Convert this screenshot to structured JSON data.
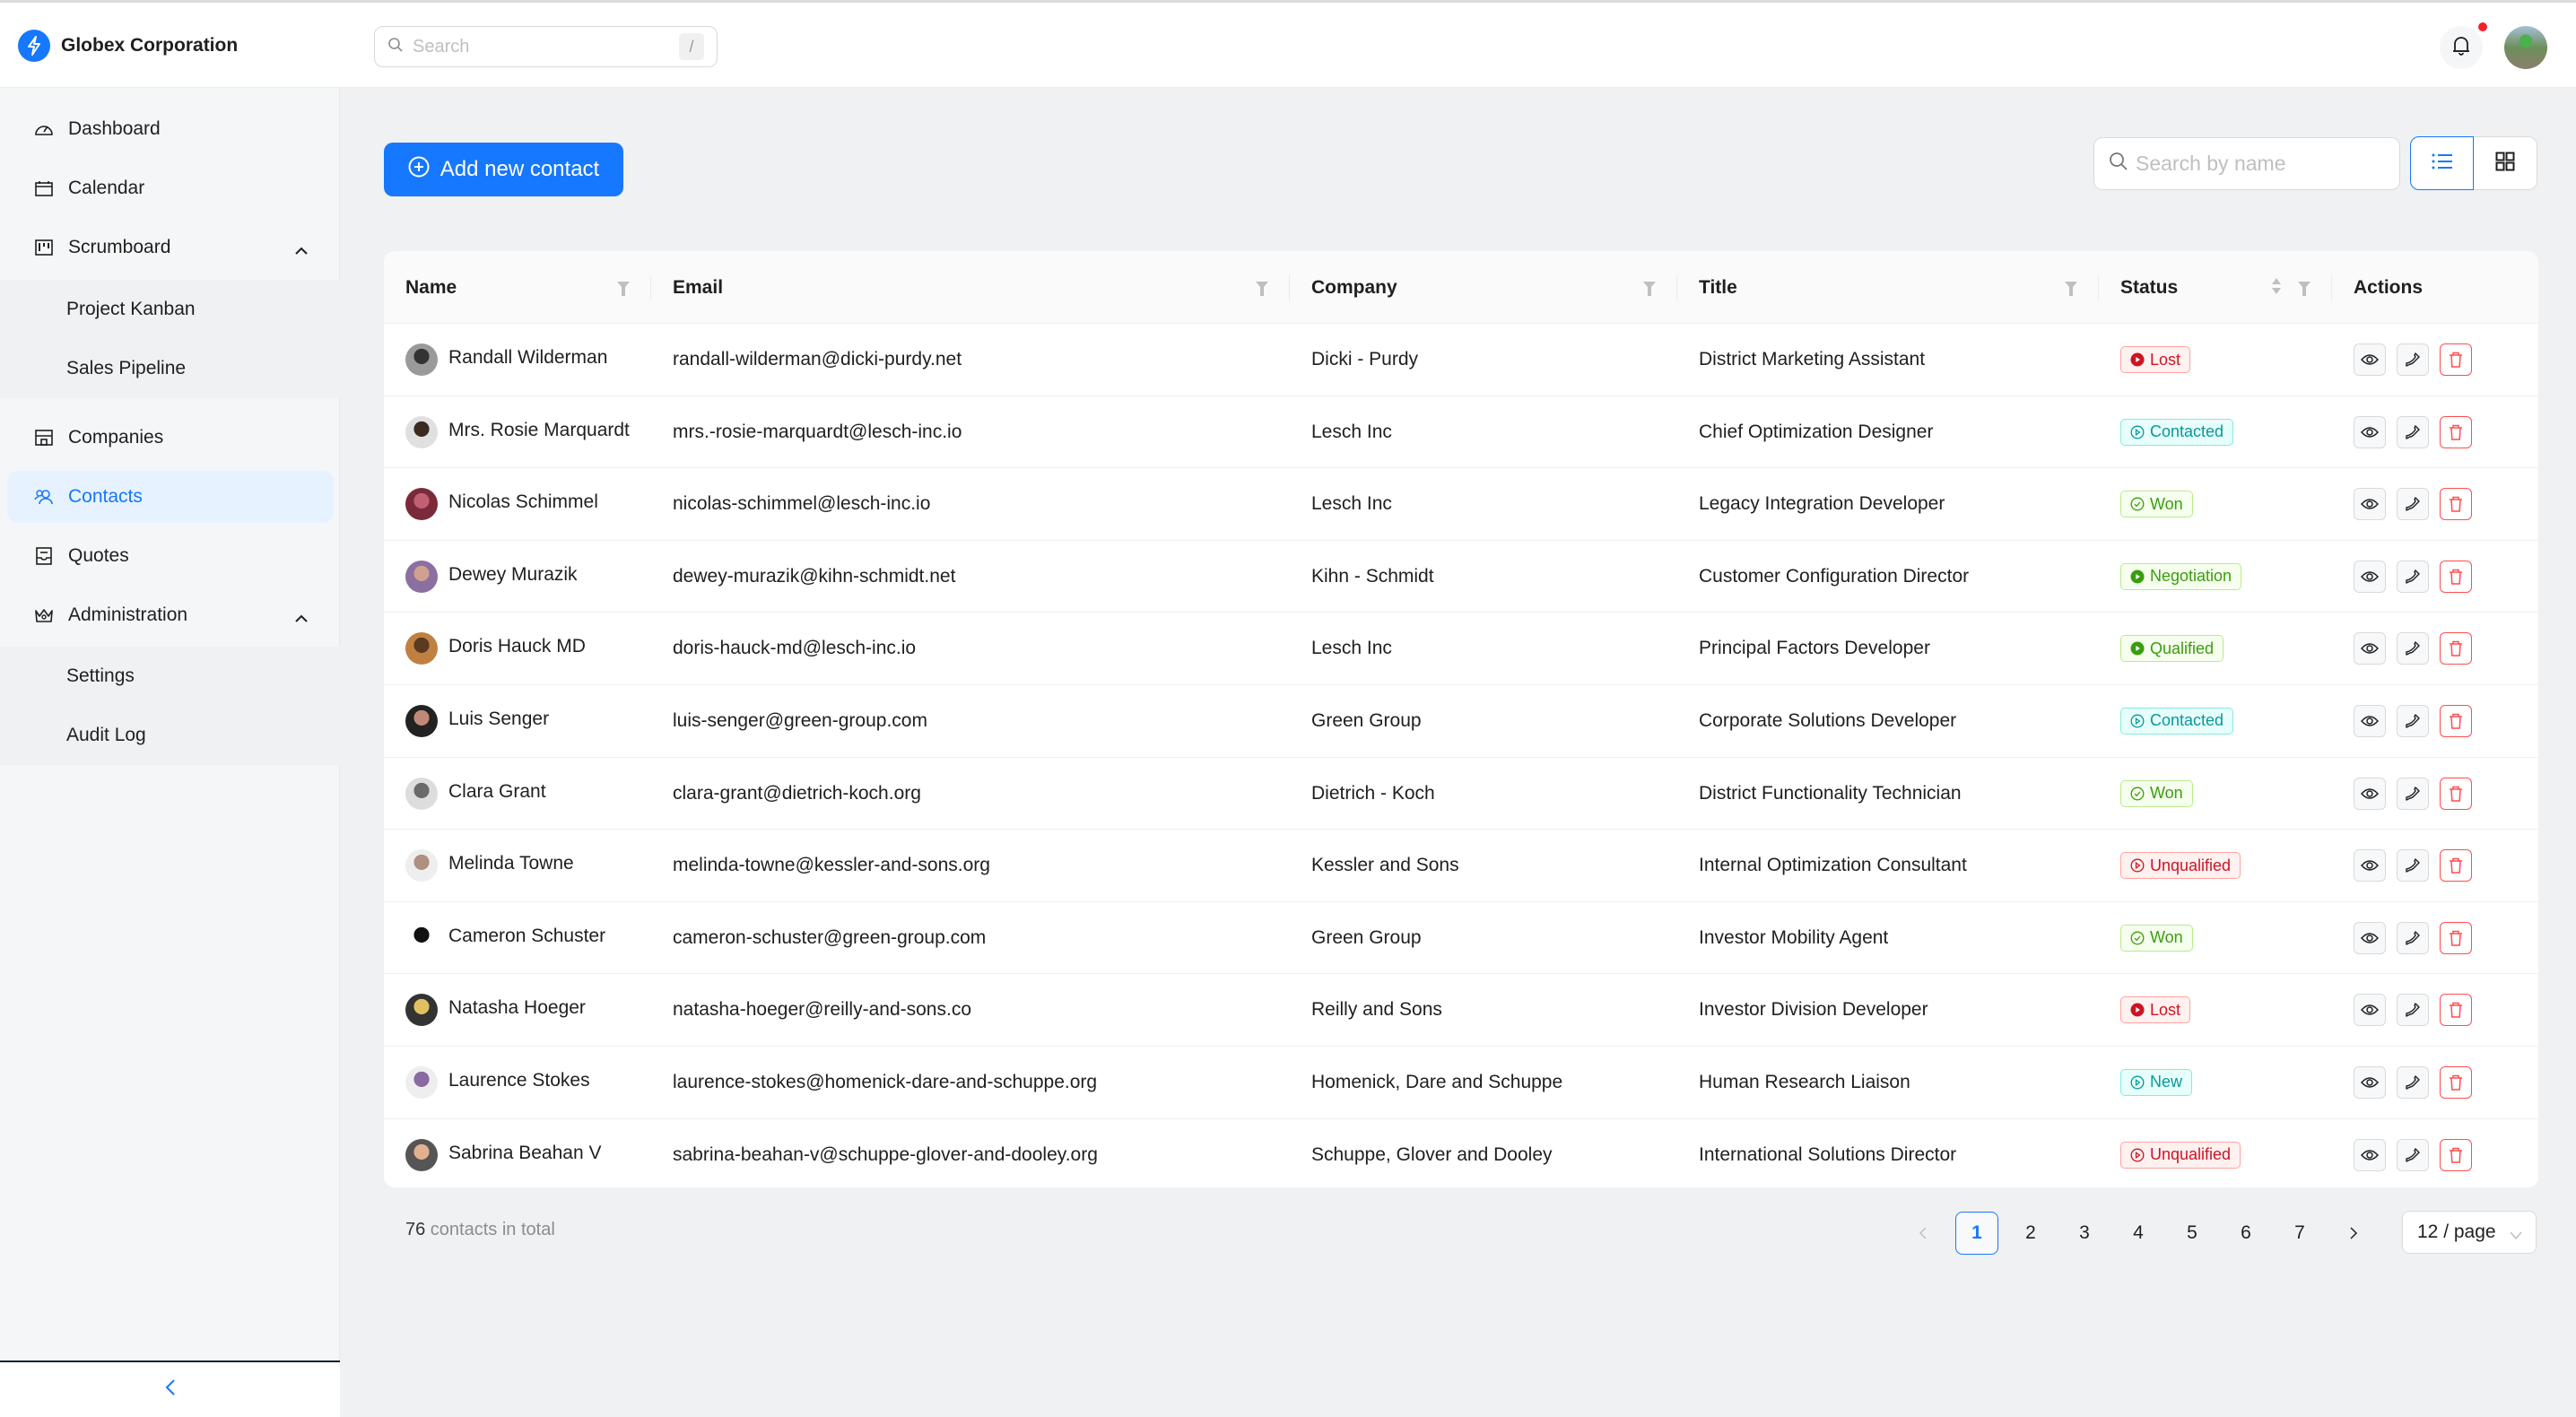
{
  "app": {
    "brand_name": "Globex Corporation",
    "search_placeholder": "Search",
    "search_shortcut": "/",
    "notification_dot_color": "#f5222d",
    "accent_color": "#1677ff"
  },
  "sidebar": {
    "items": [
      {
        "label": "Dashboard",
        "icon": "dashboard-icon"
      },
      {
        "label": "Calendar",
        "icon": "calendar-icon"
      },
      {
        "label": "Scrumboard",
        "icon": "scrumboard-icon",
        "expanded": true,
        "children": [
          {
            "label": "Project Kanban"
          },
          {
            "label": "Sales Pipeline"
          }
        ]
      },
      {
        "label": "Companies",
        "icon": "shop-icon"
      },
      {
        "label": "Contacts",
        "icon": "team-icon",
        "active": true
      },
      {
        "label": "Quotes",
        "icon": "container-icon"
      },
      {
        "label": "Administration",
        "icon": "crown-icon",
        "expanded": true,
        "children": [
          {
            "label": "Settings"
          },
          {
            "label": "Audit Log"
          }
        ]
      }
    ],
    "collapse_icon": "chevron-left-icon"
  },
  "toolbar": {
    "add_label": "Add new contact",
    "search_placeholder": "Search by name",
    "view_modes": [
      "list",
      "grid"
    ],
    "active_view": "list"
  },
  "table": {
    "columns": [
      {
        "label": "Name",
        "filter": true
      },
      {
        "label": "Email",
        "filter": true
      },
      {
        "label": "Company",
        "filter": true
      },
      {
        "label": "Title",
        "filter": true
      },
      {
        "label": "Status",
        "filter": true,
        "sort": true
      },
      {
        "label": "Actions"
      }
    ],
    "rows": [
      {
        "name": "Randall Wilderman",
        "email": "randall-wilderman@dicki-purdy.net",
        "company": "Dicki - Purdy",
        "title": "District Marketing Assistant",
        "status": "Lost"
      },
      {
        "name": "Mrs. Rosie Marquardt",
        "email": "mrs.-rosie-marquardt@lesch-inc.io",
        "company": "Lesch Inc",
        "title": "Chief Optimization Designer",
        "status": "Contacted"
      },
      {
        "name": "Nicolas Schimmel",
        "email": "nicolas-schimmel@lesch-inc.io",
        "company": "Lesch Inc",
        "title": "Legacy Integration Developer",
        "status": "Won"
      },
      {
        "name": "Dewey Murazik",
        "email": "dewey-murazik@kihn-schmidt.net",
        "company": "Kihn - Schmidt",
        "title": "Customer Configuration Director",
        "status": "Negotiation"
      },
      {
        "name": "Doris Hauck MD",
        "email": "doris-hauck-md@lesch-inc.io",
        "company": "Lesch Inc",
        "title": "Principal Factors Developer",
        "status": "Qualified"
      },
      {
        "name": "Luis Senger",
        "email": "luis-senger@green-group.com",
        "company": "Green Group",
        "title": "Corporate Solutions Developer",
        "status": "Contacted"
      },
      {
        "name": "Clara Grant",
        "email": "clara-grant@dietrich-koch.org",
        "company": "Dietrich - Koch",
        "title": "District Functionality Technician",
        "status": "Won"
      },
      {
        "name": "Melinda Towne",
        "email": "melinda-towne@kessler-and-sons.org",
        "company": "Kessler and Sons",
        "title": "Internal Optimization Consultant",
        "status": "Unqualified"
      },
      {
        "name": "Cameron Schuster",
        "email": "cameron-schuster@green-group.com",
        "company": "Green Group",
        "title": "Investor Mobility Agent",
        "status": "Won"
      },
      {
        "name": "Natasha Hoeger",
        "email": "natasha-hoeger@reilly-and-sons.co",
        "company": "Reilly and Sons",
        "title": "Investor Division Developer",
        "status": "Lost"
      },
      {
        "name": "Laurence Stokes",
        "email": "laurence-stokes@homenick-dare-and-schuppe.org",
        "company": "Homenick, Dare and Schuppe",
        "title": "Human Research Liaison",
        "status": "New"
      },
      {
        "name": "Sabrina Beahan V",
        "email": "sabrina-beahan-v@schuppe-glover-and-dooley.org",
        "company": "Schuppe, Glover and Dooley",
        "title": "International Solutions Director",
        "status": "Unqualified"
      }
    ],
    "status_styles": {
      "Lost": {
        "color": "#cf1322",
        "bg": "#fff1f0",
        "border": "#ffa39e",
        "icon": "play-circle-filled-icon"
      },
      "Contacted": {
        "color": "#08979c",
        "bg": "#e6fffb",
        "border": "#87e8de",
        "icon": "play-circle-outline-icon"
      },
      "Won": {
        "color": "#389e0d",
        "bg": "#f6ffed",
        "border": "#b7eb8f",
        "icon": "check-circle-outline-icon"
      },
      "Negotiation": {
        "color": "#389e0d",
        "bg": "#f6ffed",
        "border": "#b7eb8f",
        "icon": "play-circle-filled-icon"
      },
      "Qualified": {
        "color": "#389e0d",
        "bg": "#f6ffed",
        "border": "#b7eb8f",
        "icon": "play-circle-filled-icon"
      },
      "Unqualified": {
        "color": "#cf1322",
        "bg": "#fff1f0",
        "border": "#ffa39e",
        "icon": "play-circle-outline-icon"
      },
      "New": {
        "color": "#08979c",
        "bg": "#e6fffb",
        "border": "#87e8de",
        "icon": "play-circle-outline-icon"
      }
    },
    "row_actions": [
      "view",
      "call",
      "delete"
    ]
  },
  "footer": {
    "total_count": "76",
    "total_suffix": " contacts in total",
    "pages": [
      "1",
      "2",
      "3",
      "4",
      "5",
      "6",
      "7"
    ],
    "current_page": "1",
    "page_size": "12 / page"
  }
}
